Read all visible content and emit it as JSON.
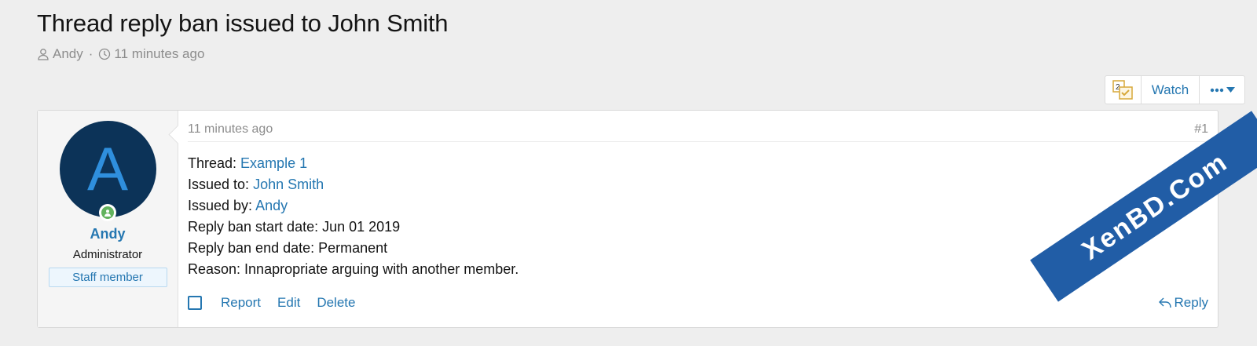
{
  "page": {
    "title": "Thread reply ban issued to John Smith",
    "author": "Andy",
    "separator": "·",
    "time": "11 minutes ago"
  },
  "buttons": {
    "watch": "Watch",
    "bookmark_badge": "2"
  },
  "post": {
    "time": "11 minutes ago",
    "number": "#1",
    "user": {
      "initial": "A",
      "name": "Andy",
      "title": "Administrator",
      "banner": "Staff member"
    },
    "lines": {
      "thread_label": "Thread: ",
      "thread_value": "Example 1",
      "issued_to_label": "Issued to: ",
      "issued_to_value": "John Smith",
      "issued_by_label": "Issued by: ",
      "issued_by_value": "Andy",
      "start_date": "Reply ban start date: Jun 01 2019",
      "end_date": "Reply ban end date: Permanent",
      "reason": "Reason: Innapropriate arguing with another member."
    },
    "actions": {
      "report": "Report",
      "edit": "Edit",
      "delete": "Delete",
      "reply": "Reply"
    }
  },
  "watermark": "XenBD.Com",
  "colors": {
    "link": "#2577b1",
    "avatar_bg": "#0c3358",
    "avatar_letter": "#2f8fdd",
    "online": "#63b35e",
    "watermark_bg": "#215da6"
  }
}
